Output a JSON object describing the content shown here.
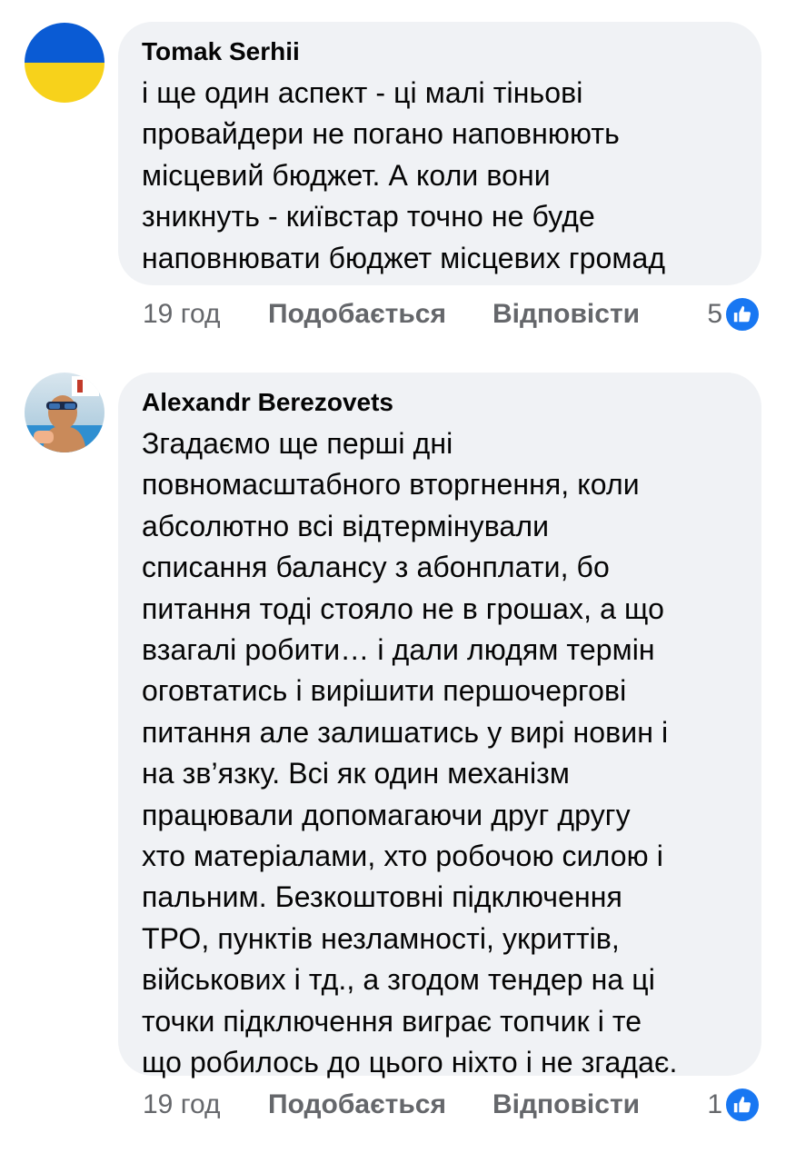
{
  "comments": [
    {
      "author": "Tomak Serhii",
      "avatar_icon": "ukraine-flag-avatar",
      "text": "і ще один аспект - ці малі тіньові\nпровайдери не погано наповнюють\nмісцевий бюджет. А коли вони\nзникнуть - київстар точно не буде\nнаповнювати бюджет місцевих громад",
      "time": "19 год",
      "like_label": "Подобається",
      "reply_label": "Відповісти",
      "reaction_count": "5",
      "reaction_icon": "like-thumb-icon"
    },
    {
      "author": "Alexandr Berezovets",
      "avatar_icon": "user-photo-avatar",
      "text": "Згадаємо ще перші дні\nповномасштабного вторгнення, коли\nабсолютно всі відтермінували\nсписання балансу з абонплати, бо\nпитання тоді стояло не в грошах, а що\nвзагалі робити… і дали людям термін\nоговтатись і вирішити першочергові\nпитання але залишатись у вирі новин і\nна зв’язку. Всі як один механізм\nпрацювали допомагаючи друг другу\nхто матеріалами, хто робочою силою і\nпальним. Безкоштовні підключення\nТРО, пунктів незламності, укриттів,\nвійськових і тд., а згодом тендер на ці\nточки підключення виграє топчик і те\nщо робилось до цього ніхто і не згадає.",
      "time": "19 год",
      "like_label": "Подобається",
      "reply_label": "Відповісти",
      "reaction_count": "1",
      "reaction_icon": "like-thumb-icon"
    }
  ],
  "colors": {
    "bubble": "#f0f2f5",
    "meta_text": "#65676b",
    "like_blue": "#1877f2",
    "flag_blue": "#0a5bd4",
    "flag_yellow": "#f7d21b"
  }
}
